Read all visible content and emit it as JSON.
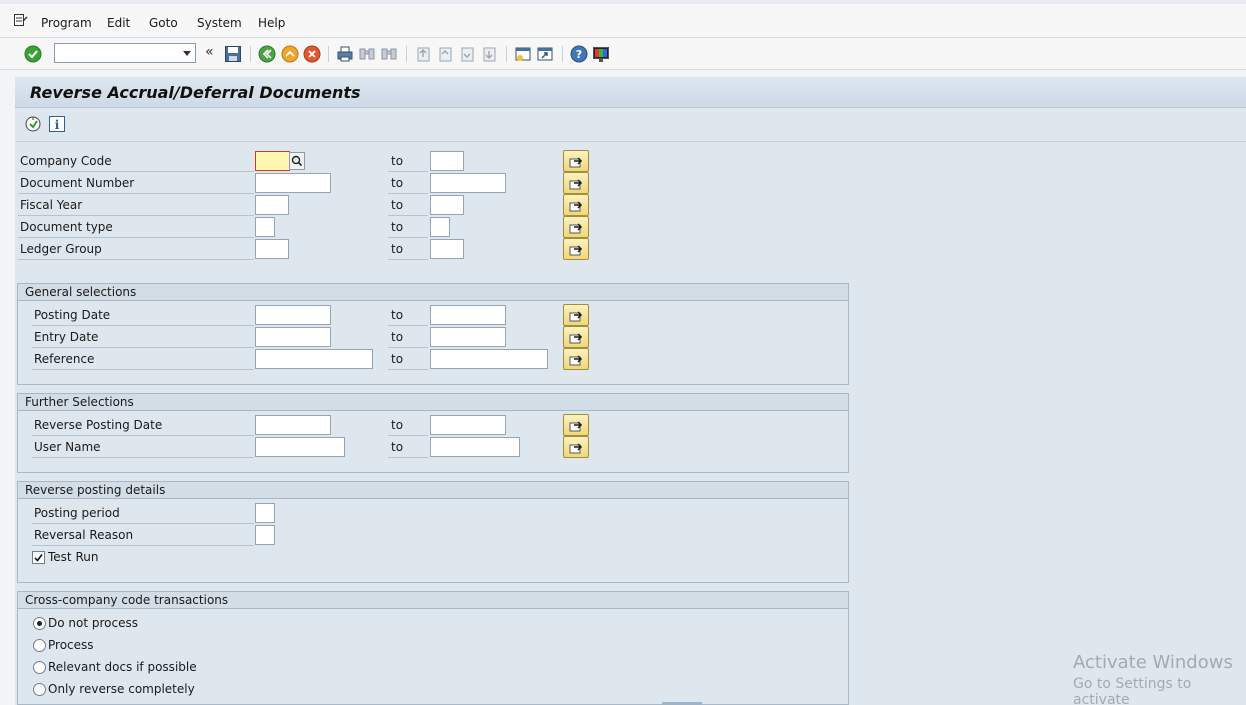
{
  "menu": {
    "items": [
      "Program",
      "Edit",
      "Goto",
      "System",
      "Help"
    ]
  },
  "toolbar": {
    "command_field_value": "",
    "icons": [
      "enter-icon",
      "save-icon",
      "back-icon",
      "exit-icon",
      "cancel-icon",
      "print-icon",
      "find-icon",
      "find-next-icon",
      "first-page-icon",
      "previous-page-icon",
      "next-page-icon",
      "last-page-icon",
      "create-session-icon",
      "shortcut-icon",
      "help-icon",
      "customize-layout-icon"
    ]
  },
  "title": "Reverse Accrual/Deferral Documents",
  "appbar": {
    "icons": [
      "execute-icon",
      "info-icon"
    ]
  },
  "to_label": "to",
  "main_fields": [
    {
      "label": "Company Code",
      "from": "",
      "to": ""
    },
    {
      "label": "Document Number",
      "from": "",
      "to": ""
    },
    {
      "label": "Fiscal Year",
      "from": "",
      "to": ""
    },
    {
      "label": "Document type",
      "from": "",
      "to": ""
    },
    {
      "label": "Ledger Group",
      "from": "",
      "to": ""
    }
  ],
  "general_selections": {
    "title": "General selections",
    "fields": [
      {
        "label": "Posting Date",
        "from": "",
        "to": ""
      },
      {
        "label": "Entry Date",
        "from": "",
        "to": ""
      },
      {
        "label": "Reference",
        "from": "",
        "to": ""
      }
    ]
  },
  "further_selections": {
    "title": "Further Selections",
    "fields": [
      {
        "label": "Reverse Posting Date",
        "from": "",
        "to": ""
      },
      {
        "label": "User Name",
        "from": "",
        "to": ""
      }
    ]
  },
  "reverse_posting": {
    "title": "Reverse posting details",
    "fields": [
      {
        "label": "Posting period",
        "value": ""
      },
      {
        "label": "Reversal Reason",
        "value": ""
      }
    ],
    "test_run_label": "Test Run",
    "test_run_checked": true
  },
  "cross_company": {
    "title": "Cross-company code transactions",
    "options": [
      "Do not process",
      "Process",
      "Relevant docs if possible",
      "Only reverse completely"
    ],
    "selected_index": 0
  },
  "watermark": {
    "line1": "Activate Windows",
    "line2": "Go to Settings to activate"
  }
}
